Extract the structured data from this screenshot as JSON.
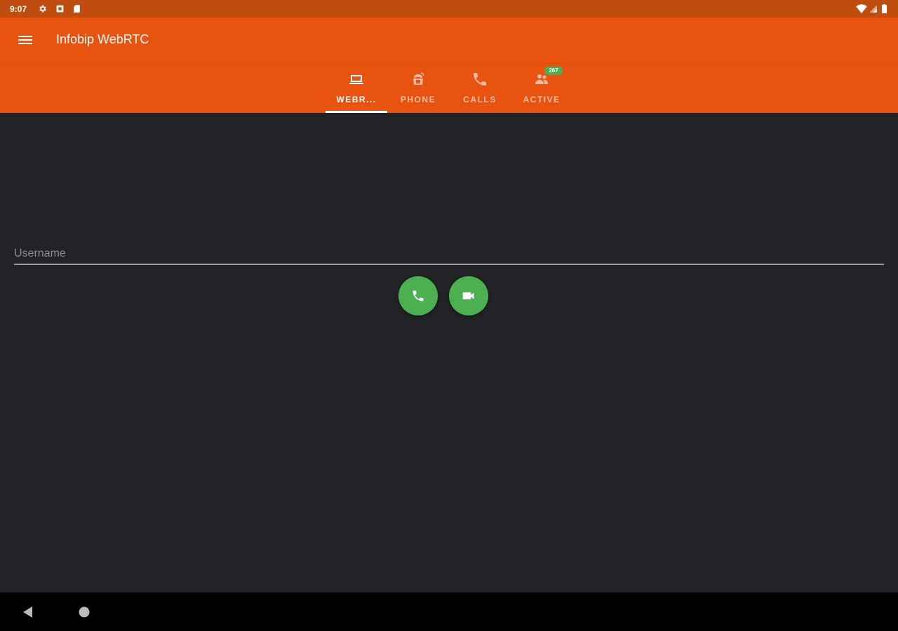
{
  "status_bar": {
    "time": "9:07"
  },
  "app_bar": {
    "title": "Infobip WebRTC",
    "color": "#E8540F"
  },
  "tabs": [
    {
      "label": "WEBR...",
      "icon": "laptop-icon",
      "active": true
    },
    {
      "label": "PHONE",
      "icon": "phone-ringing-icon",
      "active": false
    },
    {
      "label": "CALLS",
      "icon": "phone-icon",
      "active": false
    },
    {
      "label": "ACTIVE",
      "icon": "people-icon",
      "active": false,
      "badge": "267"
    }
  ],
  "form": {
    "username_placeholder": "Username",
    "username_value": ""
  },
  "actions": {
    "audio_call_icon": "phone-icon",
    "video_call_icon": "videocam-icon",
    "button_color": "#4CAF50"
  },
  "colors": {
    "status_bar": "#BE4D0F",
    "background": "#222327"
  }
}
